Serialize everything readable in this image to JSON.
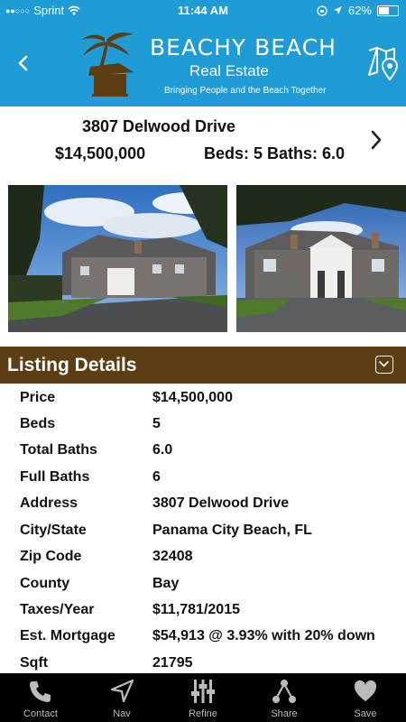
{
  "status": {
    "carrier": "Sprint",
    "time": "11:44 AM",
    "battery": "62%",
    "battery_level": 0.62
  },
  "header": {
    "brand_name": "BEACHY BEACH",
    "brand_sub": "Real Estate",
    "tagline": "Bringing People and the Beach Together",
    "back_icon": "chevron-left-icon",
    "map_icon": "map-pin-icon"
  },
  "listing": {
    "address": "3807 Delwood Drive",
    "price": "$14,500,000",
    "beds_baths": "Beds: 5  Baths: 6.0"
  },
  "details": {
    "title": "Listing Details",
    "rows": [
      {
        "label": "Price",
        "value": "$14,500,000"
      },
      {
        "label": "Beds",
        "value": "5"
      },
      {
        "label": "Total Baths",
        "value": "6.0"
      },
      {
        "label": "Full Baths",
        "value": "6"
      },
      {
        "label": "Address",
        "value": "3807 Delwood Drive"
      },
      {
        "label": "City/State",
        "value": "Panama City Beach, FL"
      },
      {
        "label": "Zip Code",
        "value": "32408"
      },
      {
        "label": "County",
        "value": "Bay"
      },
      {
        "label": "Taxes/Year",
        "value": "$11,781/2015"
      },
      {
        "label": "Est. Mortgage",
        "value": "$54,913 @ 3.93% with 20% down"
      },
      {
        "label": "Sqft",
        "value": "21795"
      }
    ]
  },
  "tabs": [
    {
      "label": "Contact",
      "icon": "phone-icon"
    },
    {
      "label": "Nav",
      "icon": "navigation-arrow-icon"
    },
    {
      "label": "Refine",
      "icon": "sliders-icon"
    },
    {
      "label": "Share",
      "icon": "share-icon"
    },
    {
      "label": "Save",
      "icon": "heart-icon"
    }
  ],
  "colors": {
    "header_blue": "#1f9bd6",
    "details_brown": "#5d3d13",
    "tabbar_black": "#000000"
  }
}
